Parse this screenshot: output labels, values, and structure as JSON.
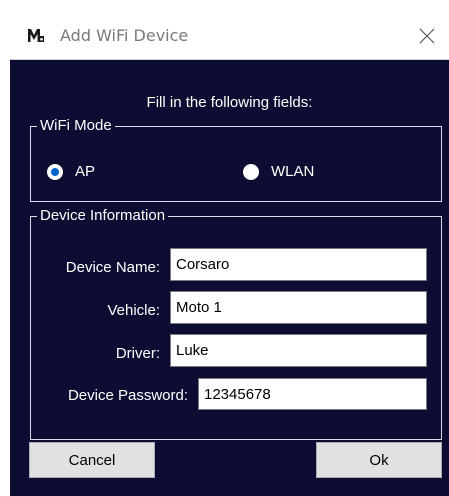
{
  "window": {
    "title": "Add WiFi Device",
    "colors": {
      "background": "#0d0d33",
      "accent": "#0063cc",
      "text": "#ffffff"
    }
  },
  "icons": {
    "app": "app-logo-icon",
    "close": "close-icon"
  },
  "form": {
    "instructions": "Fill in the following fields:",
    "wifi_mode": {
      "legend": "WiFi Mode",
      "options": [
        {
          "label": "AP",
          "selected": true
        },
        {
          "label": "WLAN",
          "selected": false
        }
      ]
    },
    "device_info": {
      "legend": "Device Information",
      "fields": {
        "device_name": {
          "label": "Device Name:",
          "value": "Corsaro"
        },
        "vehicle": {
          "label": "Vehicle:",
          "value": "Moto 1"
        },
        "driver": {
          "label": "Driver:",
          "value": "Luke"
        },
        "device_password": {
          "label": "Device Password:",
          "value": "12345678"
        }
      }
    }
  },
  "buttons": {
    "cancel": "Cancel",
    "ok": "Ok"
  }
}
